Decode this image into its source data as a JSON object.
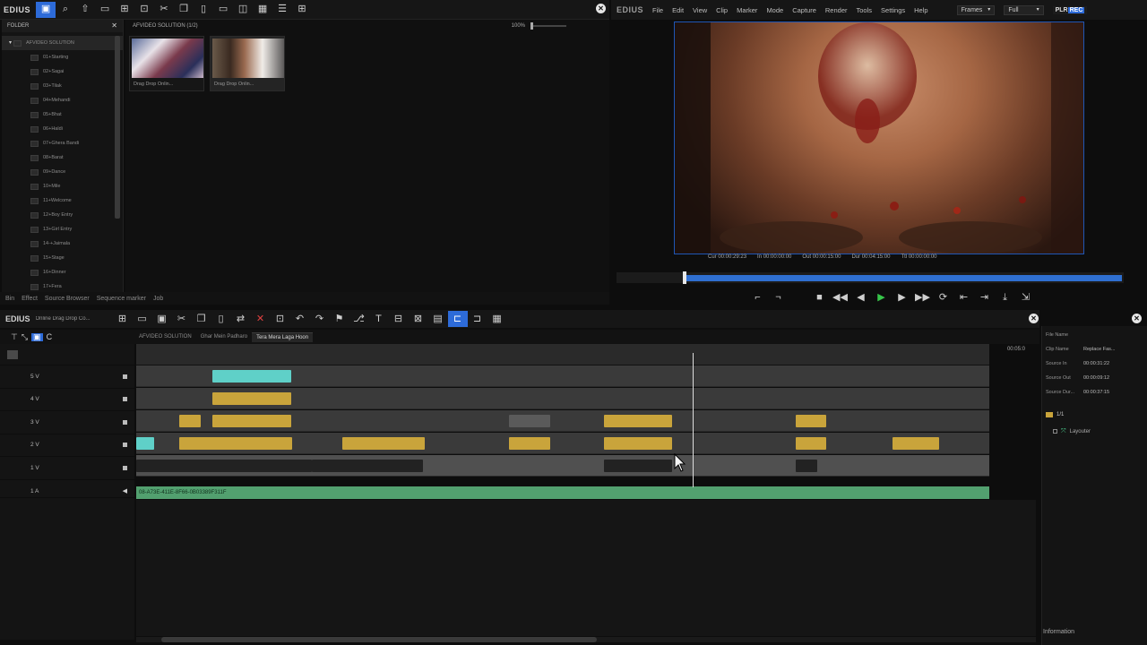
{
  "bin": {
    "logo": "EDIUS",
    "folder_header": "FOLDER",
    "root_folder": "AFVIDEO SOLUTION",
    "folders": [
      "01+Starting",
      "02+Sagai",
      "03+Tilak",
      "04+Mehandi",
      "05+Bhat",
      "06+Haldi",
      "07+Ghera Bandi",
      "08+Barat",
      "09+Dance",
      "10+Mile",
      "11+Welcome",
      "12+Boy Entry",
      "13+Girl Entry",
      "14-+Jaimala",
      "15+Stage",
      "16+Dinner",
      "17+Fera"
    ],
    "clip_path": "AFVIDEO SOLUTION (1/2)",
    "zoom": "100%",
    "clips": [
      {
        "label": "Drag Drop Onlin..."
      },
      {
        "label": "Drag Drop Onlin..."
      }
    ],
    "bottom_tabs": [
      "Bin",
      "Effect",
      "Source Browser",
      "Sequence marker",
      "Job"
    ]
  },
  "player": {
    "logo": "EDIUS",
    "menu": [
      "File",
      "Edit",
      "View",
      "Clip",
      "Marker",
      "Mode",
      "Capture",
      "Render",
      "Tools",
      "Settings",
      "Help"
    ],
    "frames_dropdown": "Frames",
    "quality_dropdown": "Full",
    "plr_rec_left": "PLR",
    "plr_rec_right": "REC",
    "timecodes": [
      "Cur 00:00:29:23",
      "In 00:00:00:00",
      "Out 00:00:15:00",
      "Dur 00:04:15:00",
      "Ttl 00:00:00:00"
    ],
    "progress": 0.02
  },
  "timeline": {
    "logo": "EDIUS",
    "project": "Online Drag Drop Co...",
    "mode_buttons": [
      "timeline-mode",
      "link-mode",
      "ripple-mode",
      "sync-mode"
    ],
    "sequence_tabs": [
      "AFVIDEO SOLUTION",
      "Ghar Mein Padharo",
      "Tera Mera Laga Hoon"
    ],
    "active_tab_index": 2,
    "tracks": [
      {
        "label": "5 V"
      },
      {
        "label": "4 V"
      },
      {
        "label": "3 V"
      },
      {
        "label": "2 V"
      },
      {
        "label": "1 V"
      },
      {
        "label": "1 A"
      }
    ],
    "audio_clip": "08-A73E-411E-8F66-0B03389F311F",
    "end_time": "00:05:0"
  },
  "info": {
    "rows": [
      {
        "k": "File Name",
        "v": ""
      },
      {
        "k": "Clip Name",
        "v": "Replace Fas..."
      },
      {
        "k": "Source In",
        "v": "00:00:31:22"
      },
      {
        "k": "Source Out",
        "v": "00:00:09:12"
      },
      {
        "k": "Source Dur...",
        "v": "00:00:37:15"
      }
    ],
    "counter": "1/1",
    "effect": "Layouter",
    "tab": "Information"
  }
}
